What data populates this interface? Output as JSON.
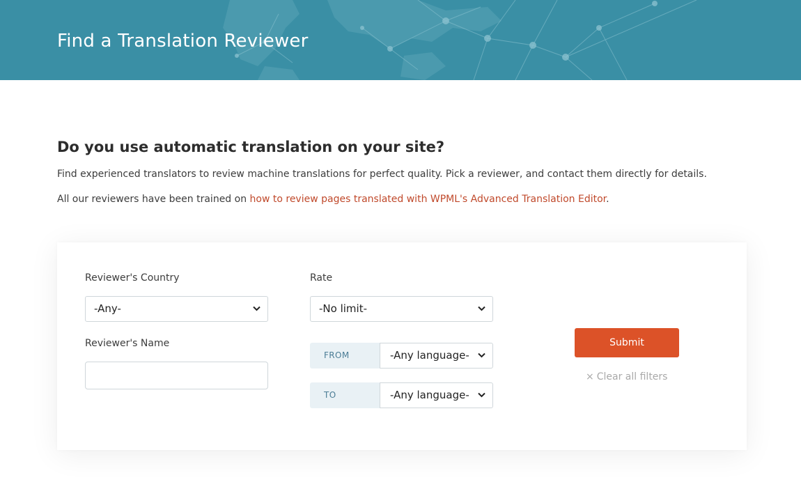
{
  "header": {
    "title": "Find a Translation Reviewer",
    "background_color": "#3a8fa5"
  },
  "intro": {
    "heading": "Do you use automatic translation on your site?",
    "description": "Find experienced translators to review machine translations for perfect quality. Pick a reviewer, and contact them directly for details.",
    "trained_prefix": "All our reviewers have been trained on ",
    "trained_link": "how to review pages translated with WPML's Advanced Translation Editor",
    "trained_suffix": ".",
    "link_color": "#c0492b"
  },
  "filters": {
    "country": {
      "label": "Reviewer's Country",
      "value": "-Any-"
    },
    "name": {
      "label": "Reviewer's Name",
      "value": ""
    },
    "rate": {
      "label": "Rate",
      "value": "-No limit-"
    },
    "from": {
      "label": "FROM",
      "value": "-Any language-"
    },
    "to": {
      "label": "TO",
      "value": "-Any language-"
    },
    "submit_label": "Submit",
    "clear_icon": "×",
    "clear_label": "Clear all filters",
    "submit_color": "#dc5228",
    "icons": {
      "dropdown": "chevron-down-icon",
      "clear": "close-icon"
    }
  }
}
